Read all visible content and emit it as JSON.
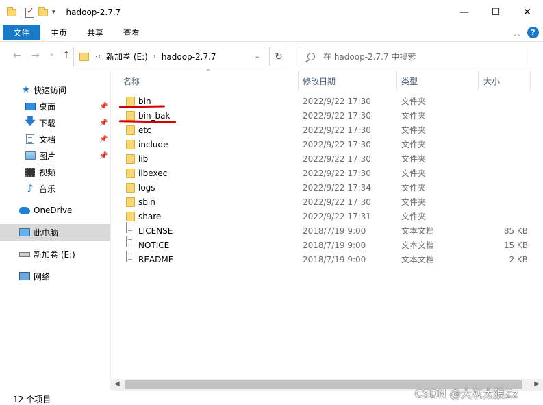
{
  "window": {
    "title": "hadoop-2.7.7",
    "minimize": "—",
    "maximize": "☐",
    "close": "✕"
  },
  "ribbon": {
    "file_tab": "文件",
    "tabs": [
      "主页",
      "共享",
      "查看"
    ],
    "help": "?"
  },
  "address": {
    "overflow": "‹‹",
    "crumbs": [
      "新加卷 (E:)",
      "hadoop-2.7.7"
    ],
    "search_placeholder": "在 hadoop-2.7.7 中搜索"
  },
  "nav": {
    "back": "←",
    "forward": "→",
    "recent": "⌄",
    "up": "↑",
    "refresh": "↻"
  },
  "sidebar": {
    "items": [
      {
        "label": "快速访问",
        "icon": "star-icon"
      },
      {
        "label": "桌面",
        "icon": "desktop-icon",
        "pinned": true
      },
      {
        "label": "下载",
        "icon": "download-icon",
        "pinned": true
      },
      {
        "label": "文档",
        "icon": "document-icon",
        "pinned": true
      },
      {
        "label": "图片",
        "icon": "picture-icon",
        "pinned": true
      },
      {
        "label": "视频",
        "icon": "video-icon"
      },
      {
        "label": "音乐",
        "icon": "music-icon"
      },
      {
        "label": "OneDrive",
        "icon": "cloud-icon"
      },
      {
        "label": "此电脑",
        "icon": "computer-icon",
        "selected": true
      },
      {
        "label": "新加卷 (E:)",
        "icon": "drive-icon"
      },
      {
        "label": "网络",
        "icon": "network-icon"
      }
    ]
  },
  "columns": {
    "name": "名称",
    "date": "修改日期",
    "type": "类型",
    "size": "大小"
  },
  "files": [
    {
      "name": "bin",
      "date": "2022/9/22 17:30",
      "type": "文件夹",
      "size": "",
      "kind": "folder"
    },
    {
      "name": "bin_bak",
      "date": "2022/9/22 17:30",
      "type": "文件夹",
      "size": "",
      "kind": "folder"
    },
    {
      "name": "etc",
      "date": "2022/9/22 17:30",
      "type": "文件夹",
      "size": "",
      "kind": "folder"
    },
    {
      "name": "include",
      "date": "2022/9/22 17:30",
      "type": "文件夹",
      "size": "",
      "kind": "folder"
    },
    {
      "name": "lib",
      "date": "2022/9/22 17:30",
      "type": "文件夹",
      "size": "",
      "kind": "folder"
    },
    {
      "name": "libexec",
      "date": "2022/9/22 17:30",
      "type": "文件夹",
      "size": "",
      "kind": "folder"
    },
    {
      "name": "logs",
      "date": "2022/9/22 17:34",
      "type": "文件夹",
      "size": "",
      "kind": "folder"
    },
    {
      "name": "sbin",
      "date": "2022/9/22 17:30",
      "type": "文件夹",
      "size": "",
      "kind": "folder"
    },
    {
      "name": "share",
      "date": "2022/9/22 17:31",
      "type": "文件夹",
      "size": "",
      "kind": "folder"
    },
    {
      "name": "LICENSE",
      "date": "2018/7/19 9:00",
      "type": "文本文档",
      "size": "85 KB",
      "kind": "file"
    },
    {
      "name": "NOTICE",
      "date": "2018/7/19 9:00",
      "type": "文本文档",
      "size": "15 KB",
      "kind": "file"
    },
    {
      "name": "README",
      "date": "2018/7/19 9:00",
      "type": "文本文档",
      "size": "2 KB",
      "kind": "file"
    }
  ],
  "status": {
    "item_count": "12 个项目"
  },
  "watermark": "CSDN @大灰太狼Zz",
  "colors": {
    "accent": "#1979ca",
    "selected_nav": "#d9d9d9",
    "annotation_red": "#d40000"
  }
}
